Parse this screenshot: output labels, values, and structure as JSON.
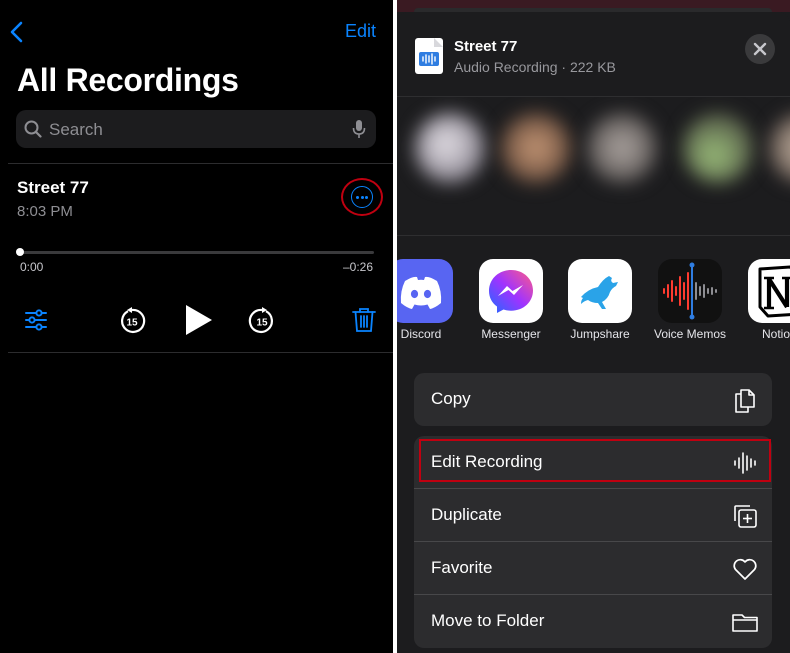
{
  "recordings_screen": {
    "edit_label": "Edit",
    "title": "All Recordings",
    "search": {
      "placeholder": "Search"
    },
    "recording": {
      "title": "Street 77",
      "time": "8:03 PM",
      "elapsed": "0:00",
      "remaining": "–0:26",
      "playback_progress": 0
    },
    "skip_back_seconds": "15",
    "skip_forward_seconds": "15"
  },
  "share_sheet": {
    "file": {
      "title": "Street 77",
      "subtitle": "Audio Recording · 222 KB"
    },
    "apps": [
      {
        "name": "Discord",
        "icon": "discord-icon"
      },
      {
        "name": "Messenger",
        "icon": "messenger-icon"
      },
      {
        "name": "Jumpshare",
        "icon": "jumpshare-icon"
      },
      {
        "name": "Voice Memos",
        "icon": "voice-memos-icon"
      },
      {
        "name": "Notio",
        "icon": "notion-icon"
      }
    ],
    "actions_primary": [
      {
        "label": "Copy",
        "icon": "copy-icon"
      }
    ],
    "actions": [
      {
        "label": "Edit Recording",
        "icon": "waveform-icon"
      },
      {
        "label": "Duplicate",
        "icon": "duplicate-icon"
      },
      {
        "label": "Favorite",
        "icon": "heart-icon"
      },
      {
        "label": "Move to Folder",
        "icon": "folder-icon"
      }
    ]
  },
  "colors": {
    "accent": "#0a84ff",
    "annotation": "#c00010",
    "background_dark": "#000000",
    "sheet_background": "#1c1c1e"
  }
}
